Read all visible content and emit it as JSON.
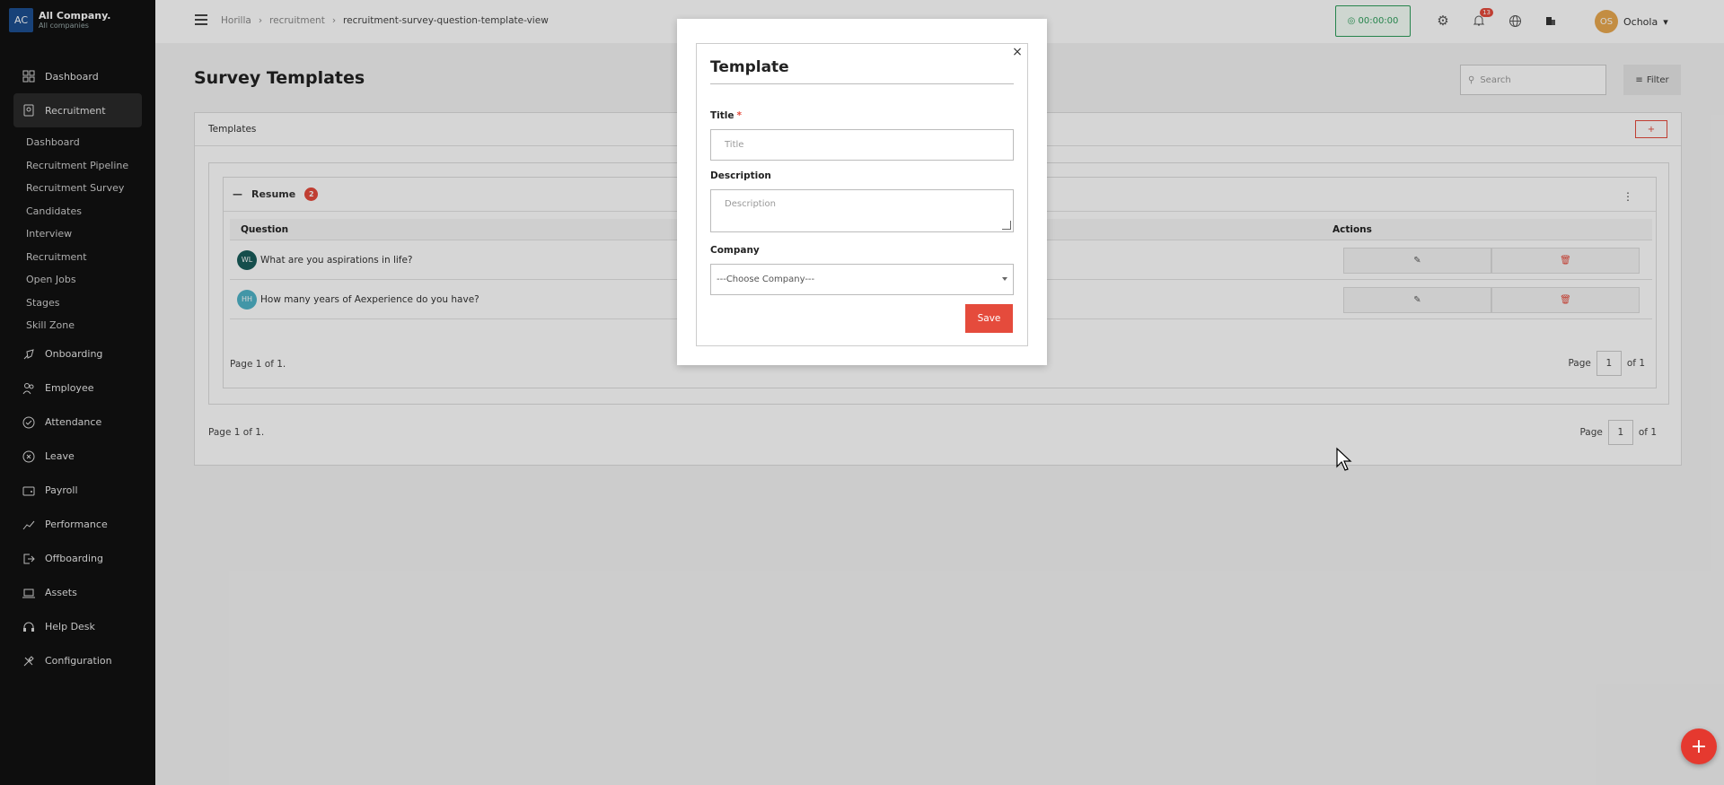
{
  "brand": {
    "logo": "AC",
    "name": "All Company.",
    "sub": "All companies"
  },
  "sidebar": {
    "items": [
      {
        "label": "Dashboard",
        "icon": "grid-icon"
      },
      {
        "label": "Recruitment",
        "icon": "recruitment-icon",
        "active": true
      },
      {
        "label": "Onboarding",
        "icon": "rocket-icon"
      },
      {
        "label": "Employee",
        "icon": "people-icon"
      },
      {
        "label": "Attendance",
        "icon": "check-circle-icon"
      },
      {
        "label": "Leave",
        "icon": "x-circle-icon"
      },
      {
        "label": "Payroll",
        "icon": "wallet-icon"
      },
      {
        "label": "Performance",
        "icon": "trend-icon"
      },
      {
        "label": "Offboarding",
        "icon": "exit-icon"
      },
      {
        "label": "Assets",
        "icon": "laptop-icon"
      },
      {
        "label": "Help Desk",
        "icon": "headset-icon"
      },
      {
        "label": "Configuration",
        "icon": "tools-icon"
      }
    ],
    "sub_items": [
      "Dashboard",
      "Recruitment Pipeline",
      "Recruitment Survey",
      "Candidates",
      "Interview",
      "Recruitment",
      "Open Jobs",
      "Stages",
      "Skill Zone"
    ]
  },
  "header": {
    "breadcrumbs": [
      "Horilla",
      "recruitment",
      "recruitment-survey-question-template-view"
    ],
    "timer": "◎ 00:00:00",
    "notification_count": "13",
    "user_initials": "OS",
    "user_name": "Ochola"
  },
  "main": {
    "title": "Survey Templates",
    "search_placeholder": "Search",
    "filter_label": "Filter",
    "card_title": "Templates",
    "add_label": "+",
    "group": {
      "name": "Resume",
      "count": "2",
      "col_question": "Question",
      "col_actions": "Actions",
      "rows": [
        {
          "initials": "WL",
          "question": "What are you aspirations in life?",
          "color": "#1a5d5b"
        },
        {
          "initials": "HH",
          "question": "How many years of Aexperience do you have?",
          "color": "#4fb3c8"
        }
      ],
      "page_text": "Page 1 of 1.",
      "page_label": "Page",
      "page_num": "1",
      "page_of": "of 1"
    },
    "outer_page_text": "Page 1 of 1.",
    "outer_page_label": "Page",
    "outer_page_num": "1",
    "outer_page_of": "of 1"
  },
  "modal": {
    "title": "Template",
    "title_label": "Title",
    "required_mark": "*",
    "title_placeholder": "Title",
    "description_label": "Description",
    "description_placeholder": "Description",
    "company_label": "Company",
    "company_selected": "---Choose Company---",
    "save_label": "Save",
    "close_symbol": "×"
  },
  "fab_label": "+",
  "colors": {
    "accent": "#e54b3c",
    "sidebar": "#111111",
    "timer": "#2e9e5b"
  }
}
